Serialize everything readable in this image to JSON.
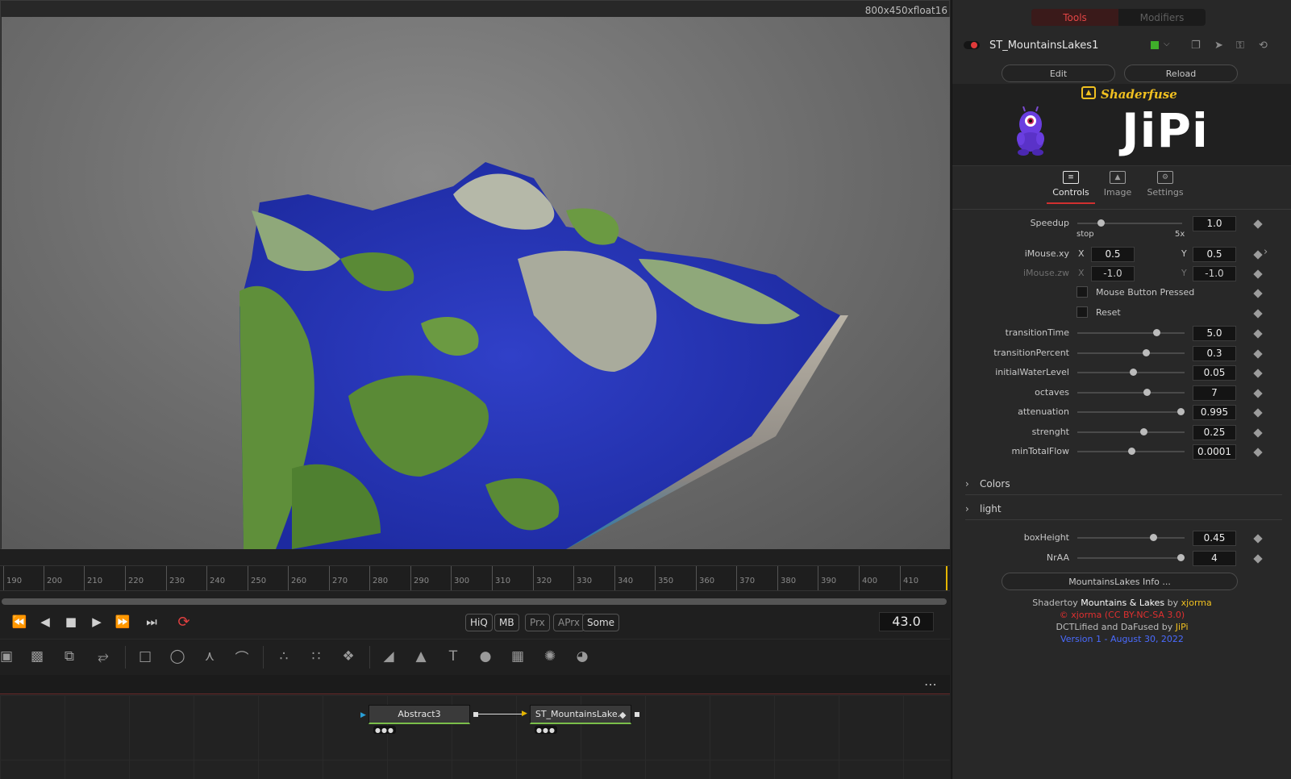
{
  "viewer": {
    "resolution": "800x450xfloat16"
  },
  "timeline": {
    "ticks": [
      "190",
      "200",
      "210",
      "220",
      "230",
      "240",
      "250",
      "260",
      "270",
      "280",
      "290",
      "300",
      "310",
      "320",
      "330",
      "340",
      "350",
      "360",
      "370",
      "380",
      "390",
      "400",
      "410"
    ],
    "frame": "43.0",
    "quality_buttons": [
      "HiQ",
      "MB",
      "Prx",
      "APrx",
      "Some"
    ]
  },
  "flow": {
    "nodes": [
      {
        "label": "Abstract3"
      },
      {
        "label": "ST_MountainsLake..."
      }
    ]
  },
  "panel": {
    "tabs": {
      "tools": "Tools",
      "modifiers": "Modifiers"
    },
    "tool_name": "ST_MountainsLakes1",
    "edit_label": "Edit",
    "reload_label": "Reload",
    "shaderfuse_label": "Shaderfuse",
    "brand": "JiPi",
    "control_tabs": [
      "Controls",
      "Image",
      "Settings"
    ],
    "speedup": {
      "label": "Speedup",
      "value": "1.0",
      "min_label": "stop",
      "max_label": "5x",
      "level": 0.22
    },
    "imouse_xy": {
      "label": "iMouse.xy",
      "x_label": "X",
      "y_label": "Y",
      "x": "0.5",
      "y": "0.5"
    },
    "imouse_zw": {
      "label": "iMouse.zw",
      "x_label": "X",
      "y_label": "Y",
      "x": "-1.0",
      "y": "-1.0"
    },
    "mouse_button": "Mouse Button Pressed",
    "reset": "Reset",
    "params": [
      {
        "label": "transitionTime",
        "value": "5.0",
        "level": 0.74
      },
      {
        "label": "transitionPercent",
        "value": "0.3",
        "level": 0.64
      },
      {
        "label": "initialWaterLevel",
        "value": "0.05",
        "level": 0.52
      },
      {
        "label": "octaves",
        "value": "7",
        "level": 0.65
      },
      {
        "label": "attenuation",
        "value": "0.995",
        "level": 0.96
      },
      {
        "label": "strenght",
        "value": "0.25",
        "level": 0.62
      },
      {
        "label": "minTotalFlow",
        "value": "0.0001",
        "level": 0.5
      }
    ],
    "sections": [
      "Colors",
      "light"
    ],
    "light_params": [
      {
        "label": "boxHeight",
        "value": "0.45",
        "level": 0.71
      },
      {
        "label": "NrAA",
        "value": "4",
        "level": 0.96
      }
    ],
    "info_button": "MountainsLakes Info ...",
    "credits": {
      "line1_a": "Shadertoy ",
      "line1_b": "Mountains & Lakes",
      "line1_c": " by ",
      "line1_d": "xjorma",
      "line2": "© xjorma (CC BY-NC-SA 3.0)",
      "line3_a": "DCTLified and DaFused by ",
      "line3_b": "JiPi",
      "line4": "Version 1 - August 30, 2022"
    },
    "colors": {
      "accent_red": "#d03030",
      "credit_yellow": "#f0c020",
      "credit_blue": "#4a6bff"
    }
  }
}
